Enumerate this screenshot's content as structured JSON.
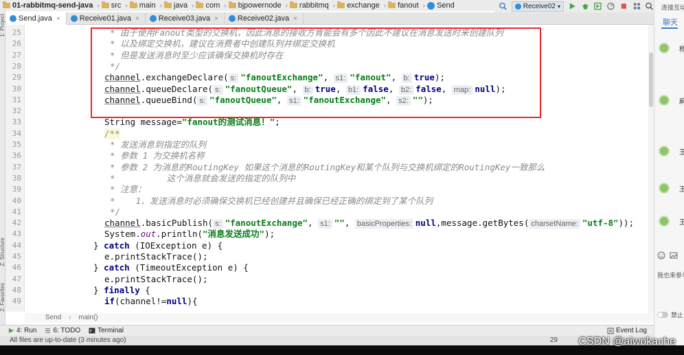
{
  "breadcrumb": [
    "01-rabbitmq-send-java",
    "src",
    "main",
    "java",
    "com",
    "bjpowernode",
    "rabbitmq",
    "exchange",
    "fanout",
    "Send"
  ],
  "toolbar": {
    "run_config": "Receive02"
  },
  "tabs": [
    {
      "label": "Send.java",
      "active": true
    },
    {
      "label": "Receive01.java",
      "active": false
    },
    {
      "label": "Receive03.java",
      "active": false
    },
    {
      "label": "Receive02.java",
      "active": false
    }
  ],
  "side_labels": {
    "project": "1: Project",
    "structure": "Z: Structure",
    "favorites": "2: Favorites"
  },
  "line_numbers": [
    "25",
    "26",
    "27",
    "28",
    "29",
    "30",
    "31",
    "32",
    "33",
    "34",
    "35",
    "36",
    "37",
    "38",
    "39",
    "40",
    "41",
    "42",
    "43",
    "44",
    "45",
    "46",
    "47",
    "48",
    "49"
  ],
  "code": {
    "l25": "* 由于使用Fanout类型的交换机，因此消息的接收方肯能会有多个因此不建议在消息发送时来创建队列",
    "l26": "* 以及绑定交换机，建议在消费者中创建队列并绑定交换机",
    "l27": "* 但是发送消息时至少应该确保交换机时存在",
    "l28": "*/",
    "l29": {
      "obj": "channel",
      "call": ".exchangeDeclare(",
      "h1": "s:",
      "a1": "\"fanoutExchange\"",
      "h2": "s1:",
      "a2": "\"fanout\"",
      "h3": "b:",
      "a3": "true",
      "end": ");"
    },
    "l30": {
      "obj": "channel",
      "call": ".queueDeclare(",
      "h1": "s:",
      "a1": "\"fanoutQueue\"",
      "h2": "b:",
      "a2": "true",
      "h3": "b1:",
      "a3": "false",
      "h4": "b2:",
      "a4": "false",
      "h5": "map:",
      "a5": "null",
      "end": ");"
    },
    "l31": {
      "obj": "channel",
      "call": ".queueBind(",
      "h1": "s:",
      "a1": "\"fanoutQueue\"",
      "h2": "s1:",
      "a2": "\"fanoutExchange\"",
      "h3": "s2:",
      "a3": "\"\"",
      "end": ");"
    },
    "l33": {
      "pre": "String message=",
      "str": "\"fanout的测试消息！\"",
      "end": ";"
    },
    "l34": "/**",
    "l35": "* 发送消息到指定的队列",
    "l36": "* 参数 1 为交换机名称",
    "l37": "* 参数 2 为消息的RoutingKey 如果这个消息的RoutingKey和某个队列与交换机绑定的RoutingKey一致那么",
    "l38": "*          这个消息就会发送的指定的队列中",
    "l39": "* 注意：",
    "l40": "*    1、发送消息时必须确保交换机已经创建并且确保已经正确的绑定到了某个队列",
    "l41": "*/",
    "l42": {
      "obj": "channel",
      "call": ".basicPublish(",
      "h1": "s:",
      "a1": "\"fanoutExchange\"",
      "h2": "s1:",
      "a2": "\"\"",
      "h3": "basicProperties:",
      "a3": "null",
      "mid": ",message.getBytes(",
      "h4": "charsetName:",
      "a4": "\"utf-8\"",
      "end": "));"
    },
    "l43": {
      "pre": "System.",
      "field": "out",
      "post": ".println(",
      "str": "\"消息发送成功\"",
      "end": ");"
    },
    "l44": {
      "pre": "} ",
      "kw": "catch",
      "post": " (IOException e) {"
    },
    "l45": "e.printStackTrace();",
    "l46": {
      "pre": "} ",
      "kw": "catch",
      "post": " (TimeoutException e) {"
    },
    "l47": "e.printStackTrace();",
    "l48": {
      "pre": "} ",
      "kw": "finally",
      "post": " {"
    },
    "l49": {
      "kw": "if",
      "pre": "(channel!=",
      "kw2": "null",
      "post": "){"
    }
  },
  "editor_crumb": {
    "cls": "Send",
    "method": "main()"
  },
  "toolwindows": {
    "run": "4: Run",
    "todo": "6: TODO",
    "terminal": "Terminal",
    "event_log": "Event Log"
  },
  "status": {
    "message": "All files are up-to-date (3 minutes ago)",
    "position": "29"
  },
  "chat": {
    "top": "连接互动",
    "tab": "聊天",
    "users": [
      "杨",
      "麻",
      "王",
      "王",
      "王"
    ],
    "input_text": "我也来参与...",
    "toggle_label": "禁止"
  },
  "watermark": "CSDN @aiwokache",
  "colors": {
    "highlight": "#e8262a",
    "string": "#067d17",
    "keyword": "#000080",
    "comment": "#8a8a8a"
  }
}
